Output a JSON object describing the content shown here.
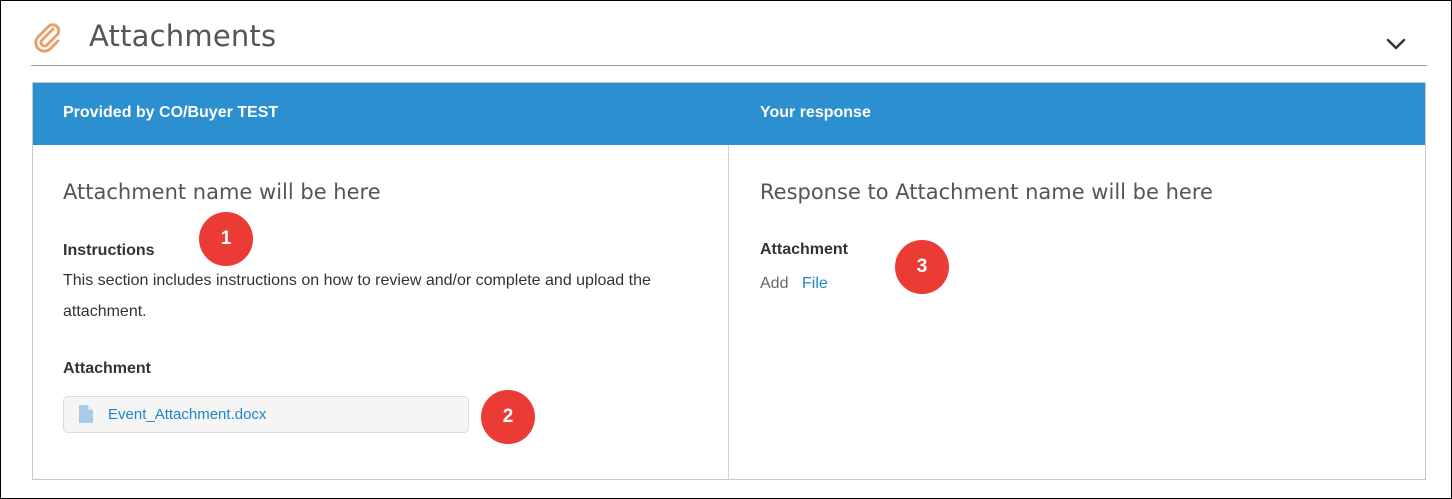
{
  "section": {
    "title": "Attachments",
    "icon": "paperclip-icon",
    "collapse_icon": "chevron-down-icon",
    "accent_color": "#e8a06a"
  },
  "table": {
    "header_color": "#2b8fd0",
    "left_header": "Provided by CO/Buyer TEST",
    "right_header": "Your response"
  },
  "left": {
    "title": "Attachment name will be here",
    "instructions_label": "Instructions",
    "instructions_text": "This section includes instructions on how to review and/or complete and upload the attachment.",
    "attachment_label": "Attachment",
    "file_name": "Event_Attachment.docx",
    "file_icon": "document-icon"
  },
  "right": {
    "title": "Response to Attachment name will be here",
    "attachment_label": "Attachment",
    "add_text": "Add",
    "file_link": "File"
  },
  "callouts": {
    "color": "#ea3b35",
    "one": "1",
    "two": "2",
    "three": "3"
  }
}
